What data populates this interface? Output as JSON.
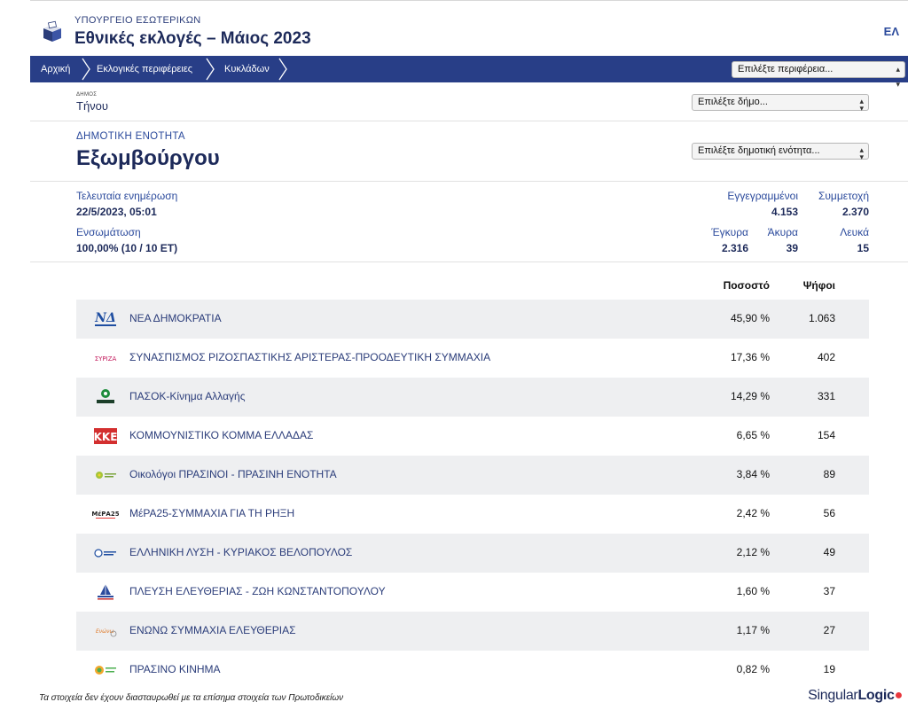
{
  "header": {
    "ministry": "ΥΠΟΥΡΓΕΙΟ ΕΣΩΤΕΡΙΚΩΝ",
    "title": "Εθνικές εκλογές – Μάιος 2023",
    "lang": "ΕΛ"
  },
  "nav": {
    "crumbs": [
      "Αρχική",
      "Εκλογικές περιφέρειες",
      "Κυκλάδων"
    ],
    "region_select": "Επιλέξτε περιφέρεια..."
  },
  "municipality": {
    "label": "ΔΗΜΟΣ",
    "name": "Τήνου",
    "select": "Επιλέξτε δήμο..."
  },
  "unit": {
    "label": "ΔΗΜΟΤΙΚΗ ΕΝΟΤΗΤΑ",
    "name": "Εξωμβούργου",
    "select": "Επιλέξτε δημοτική ενότητα..."
  },
  "stats": {
    "last_update_label": "Τελευταία ενημέρωση",
    "last_update_value": "22/5/2023, 05:01",
    "integration_label": "Ενσωμάτωση",
    "integration_value": "100,00% (10 / 10 ΕΤ)",
    "registered_label": "Εγγεγραμμένοι",
    "registered_value": "4.153",
    "turnout_label": "Συμμετοχή",
    "turnout_value": "2.370",
    "valid_label": "Έγκυρα",
    "valid_value": "2.316",
    "invalid_label": "Άκυρα",
    "invalid_value": "39",
    "blank_label": "Λευκά",
    "blank_value": "15"
  },
  "table": {
    "col_pct": "Ποσοστό",
    "col_votes": "Ψήφοι",
    "rows": [
      {
        "name": "ΝΕΑ ΔΗΜΟΚΡΑΤΙΑ",
        "pct": "45,90 %",
        "votes": "1.063",
        "logo": "nd-logo"
      },
      {
        "name": "ΣΥΝΑΣΠΙΣΜΟΣ ΡΙΖΟΣΠΑΣΤΙΚΗΣ ΑΡΙΣΤΕΡΑΣ-ΠΡΟΟΔΕΥΤΙΚΗ ΣΥΜΜΑΧΙΑ",
        "pct": "17,36 %",
        "votes": "402",
        "logo": "syriza-logo"
      },
      {
        "name": "ΠΑΣΟΚ-Κίνημα Αλλαγής",
        "pct": "14,29 %",
        "votes": "331",
        "logo": "pasok-logo"
      },
      {
        "name": "ΚΟΜΜΟΥΝΙΣΤΙΚΟ ΚΟΜΜΑ ΕΛΛΑΔΑΣ",
        "pct": "6,65 %",
        "votes": "154",
        "logo": "kke-logo"
      },
      {
        "name": "Οικολόγοι ΠΡΑΣΙΝΟΙ - ΠΡΑΣΙΝΗ ΕΝΟΤΗΤΑ",
        "pct": "3,84 %",
        "votes": "89",
        "logo": "greens-logo"
      },
      {
        "name": "ΜέΡΑ25-ΣΥΜΜΑΧΙΑ ΓΙΑ ΤΗ ΡΗΞΗ",
        "pct": "2,42 %",
        "votes": "56",
        "logo": "mera25-logo"
      },
      {
        "name": "ΕΛΛΗΝΙΚΗ ΛΥΣΗ - ΚΥΡΙΑΚΟΣ ΒΕΛΟΠΟΥΛΟΣ",
        "pct": "2,12 %",
        "votes": "49",
        "logo": "elliniki-lysi-logo"
      },
      {
        "name": "ΠΛΕΥΣΗ ΕΛΕΥΘΕΡΙΑΣ - ΖΩΗ ΚΩΝΣΤΑΝΤΟΠΟΥΛΟΥ",
        "pct": "1,60 %",
        "votes": "37",
        "logo": "plefsi-logo"
      },
      {
        "name": "ΕΝΩΝΩ ΣΥΜΜΑΧΙΑ ΕΛΕΥΘΕΡΙΑΣ",
        "pct": "1,17 %",
        "votes": "27",
        "logo": "enono-logo"
      },
      {
        "name": "ΠΡΑΣΙΝΟ ΚΙΝΗΜΑ",
        "pct": "0,82 %",
        "votes": "19",
        "logo": "prasino-kinima-logo"
      }
    ]
  },
  "footer": {
    "note": "Τα στοιχεία δεν έχουν διασταυρωθεί με τα επίσημα στοιχεία των Πρωτοδικείων",
    "brand_a": "Singular",
    "brand_b": "Logic"
  },
  "colors": {
    "nav_bg": "#283e87",
    "title": "#1d2a5a",
    "label_blue": "#2b4a9c",
    "row_shade": "#eeeff1"
  }
}
